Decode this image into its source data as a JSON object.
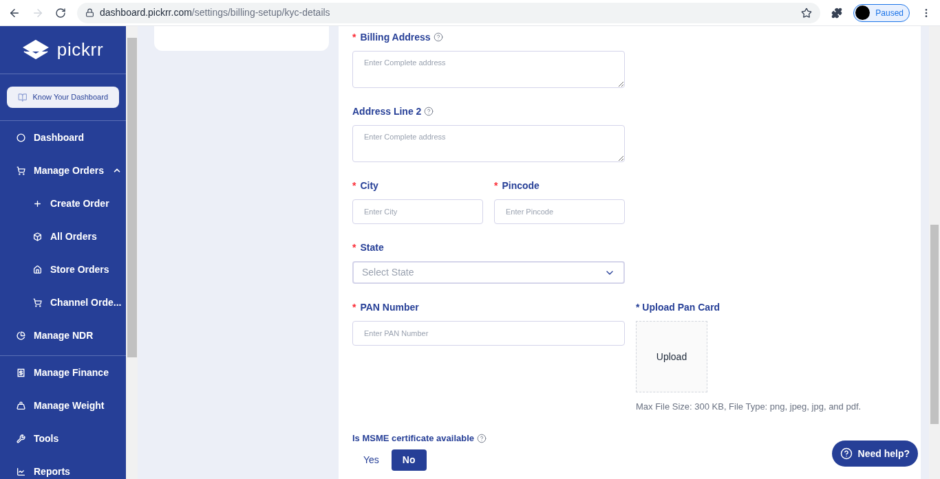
{
  "browser": {
    "url_host": "dashboard.pickrr.com",
    "url_path": "/settings/billing-setup/kyc-details",
    "profile_status": "Paused"
  },
  "sidebar": {
    "logo": "pickrr",
    "guide_button": "Know Your Dashboard",
    "groups": [
      {
        "items": [
          {
            "label": "Dashboard"
          },
          {
            "label": "Manage Orders",
            "expanded": true,
            "children": [
              {
                "label": "Create Order"
              },
              {
                "label": "All Orders"
              },
              {
                "label": "Store Orders"
              },
              {
                "label": "Channel Orde..."
              }
            ]
          },
          {
            "label": "Manage NDR"
          }
        ]
      },
      {
        "items": [
          {
            "label": "Manage Finance"
          },
          {
            "label": "Manage Weight"
          },
          {
            "label": "Tools"
          },
          {
            "label": "Reports"
          }
        ]
      }
    ]
  },
  "form": {
    "rows": [
      {
        "fields": [
          {
            "kind": "textarea",
            "required_mark": "*",
            "label": "Billing Address",
            "help": true,
            "placeholder": "Enter Complete address"
          }
        ]
      },
      {
        "fields": [
          {
            "kind": "textarea",
            "label": "Address Line 2",
            "help": true,
            "placeholder": "Enter Complete address"
          }
        ]
      },
      {
        "fields": [
          {
            "kind": "input",
            "required_mark": "*",
            "label": "City",
            "help": false,
            "placeholder": "Enter City"
          },
          {
            "kind": "input",
            "required_mark": "*",
            "label": "Pincode",
            "help": false,
            "placeholder": "Enter Pincode"
          }
        ]
      },
      {
        "fields": [
          {
            "kind": "select",
            "required_mark": "*",
            "label": "State",
            "help": false,
            "placeholder": "Select State"
          }
        ]
      },
      {
        "fields": [
          {
            "kind": "input",
            "required_mark": "*",
            "label": "PAN Number",
            "help": false,
            "placeholder": "Enter PAN Number"
          },
          {
            "kind": "upload",
            "label": "* Upload Pan Card",
            "help": false,
            "button": "Upload",
            "note": "Max File Size: 300 KB, File Type: png, jpeg, jpg, and pdf."
          }
        ]
      }
    ],
    "msme": {
      "question": "Is MSME certificate available",
      "options": [
        {
          "label": "Yes",
          "selected": false
        },
        {
          "label": "No",
          "selected": true
        }
      ]
    }
  },
  "help_button": "Need help?"
}
